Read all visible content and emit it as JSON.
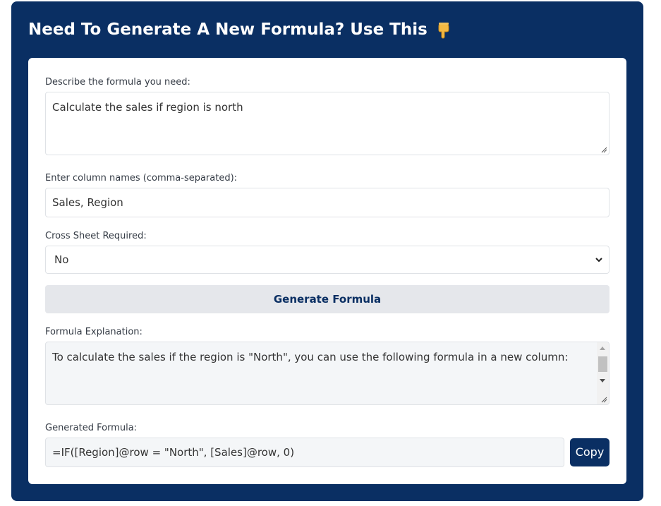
{
  "header": {
    "title": "Need To Generate A New Formula? Use This",
    "emoji_icon": "backhand-index-pointing-down-icon"
  },
  "form": {
    "description": {
      "label": "Describe the formula you need:",
      "value": "Calculate the sales if region is north"
    },
    "columns": {
      "label": "Enter column names (comma-separated):",
      "value": "Sales, Region"
    },
    "cross_sheet": {
      "label": "Cross Sheet Required:",
      "selected": "No"
    },
    "generate_button_label": "Generate Formula",
    "explanation": {
      "label": "Formula Explanation:",
      "value": "To calculate the sales if the region is \"North\", you can use the following formula in a new column:"
    },
    "generated": {
      "label": "Generated Formula:",
      "value": "=IF([Region]@row = \"North\", [Sales]@row, 0)"
    },
    "copy_button_label": "Copy"
  },
  "colors": {
    "brand": "#0a2f63",
    "button_bg": "#e5e7eb",
    "readonly_bg": "#f4f6f8"
  }
}
